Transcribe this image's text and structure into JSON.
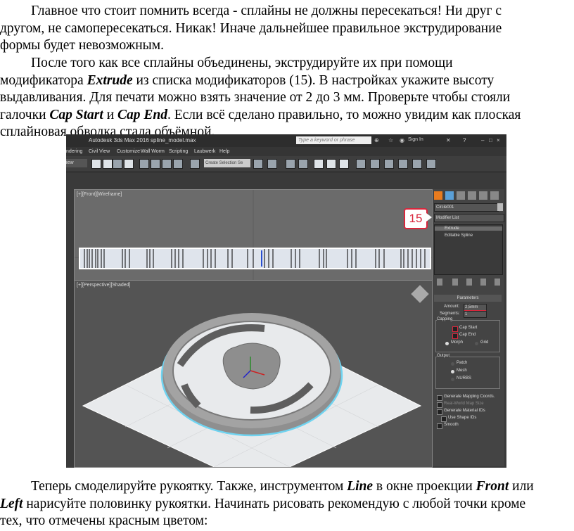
{
  "paragraphs": {
    "p1": {
      "l1": "Главное что стоит помнить всегда - сплайны не должны пересекаться! Ни друг с",
      "l2": "другом, не самопересекаться. Никак! Иначе дальнейшее правильное экструдирование",
      "l3": "формы будет невозможным."
    },
    "p2": {
      "l1": "После того как все сплайны объединены, экструдируйте их при помощи",
      "l2a": "модификатора ",
      "l2b": "Extrude",
      "l2c": " из списка модификаторов (15). В настройках укажите высоту",
      "l3": "выдавливания. Для печати можно взять значение от 2 до 3 мм. Проверьте чтобы стояли",
      "l4a": "галочки ",
      "l4b": "Cap Start",
      "l4c": " и ",
      "l4d": "Cap End",
      "l4e": ". Если всё сделано правильно, то можно увидим как плоская",
      "l5": "сплайновая обводка стала объёмной."
    },
    "p3": {
      "l1a": "Теперь смоделируйте рукоятку. Также, инструментом ",
      "l1b": "Line",
      "l1c": " в окне проекции ",
      "l1d": "Front",
      "l1e": " или",
      "l2a": "Left",
      "l2b": " нарисуйте половинку рукоятки. Начинать рисовать рекомендую с любой точки кроме",
      "l3": "тех, что отмечены красным цветом:"
    }
  },
  "app": {
    "title": "Autodesk 3ds Max 2016    spline_model.max",
    "search_placeholder": "Type a keyword or phrase",
    "sign_in": "Sign In",
    "menu": [
      "ndering",
      "Civil View",
      "Customize",
      "Wall Worm",
      "Scripting",
      "Laubwerk",
      "Help"
    ],
    "view_dropdown": "iew",
    "selection_set": "Create Selection Se",
    "viewport_front_label": "[+][Front][Wireframe]",
    "viewport_persp_label": "[+][Perspective][Shaded]",
    "object_name": "Circle001",
    "modifier_list": "Modifier List",
    "modifier_stack": [
      "Extrude",
      "Editable Spline"
    ],
    "params_header": "Parameters",
    "amount_label": "Amount:",
    "amount_value": "2,5mm",
    "segments_label": "Segments:",
    "segments_value": "1",
    "capping_label": "Capping",
    "cap_start": "Cap Start",
    "cap_end": "Cap End",
    "morph": "Morph",
    "grid": "Grid",
    "output_label": "Output",
    "patch": "Patch",
    "mesh": "Mesh",
    "nurbs": "NURBS",
    "gen_mapping": "Generate Mapping Coords.",
    "real_world": "Real-World Map Size",
    "gen_material": "Generate Material IDs",
    "use_shape_ids": "Use Shape IDs",
    "smooth": "Smooth",
    "callout": "15",
    "accent_color": "#d9263c"
  }
}
